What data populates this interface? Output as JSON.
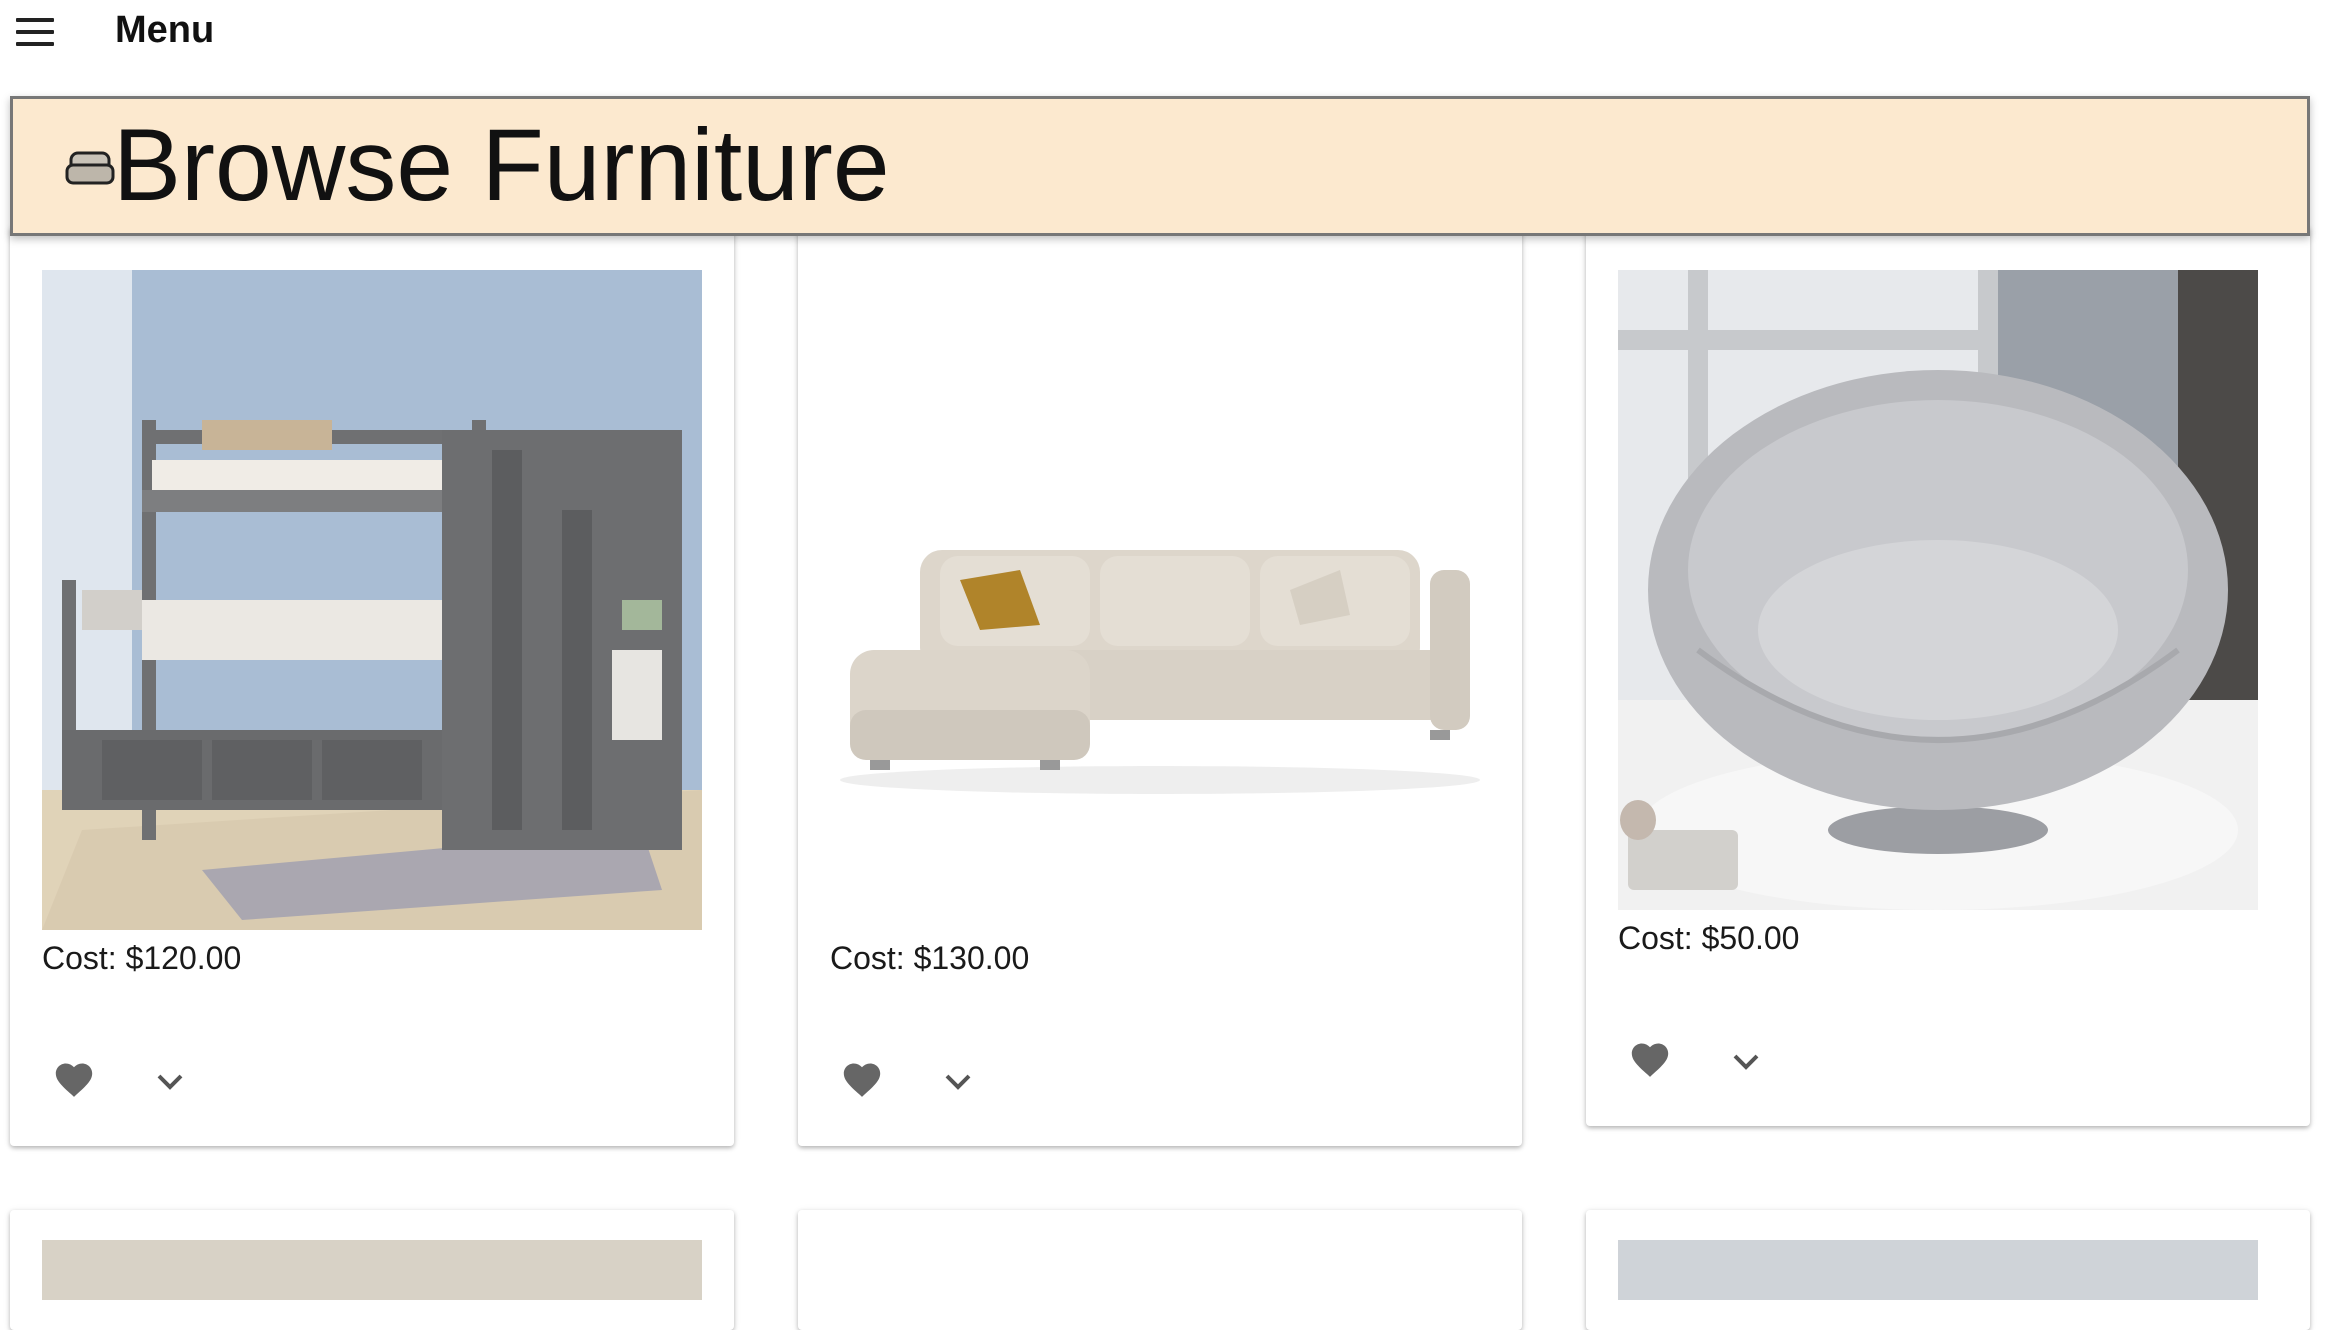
{
  "topbar": {
    "menu_label": "Menu",
    "menu_icon": "hamburger-icon"
  },
  "header": {
    "title": "Browse Furniture",
    "icon": "sofa-icon",
    "bg_color": "#fce9cf"
  },
  "products": [
    {
      "image": "bunk-bed",
      "cost": "Cost: $120.00"
    },
    {
      "image": "sectional-sofa",
      "cost": "Cost: $130.00"
    },
    {
      "image": "papasan-swivel-chair",
      "cost": "Cost: $50.00"
    }
  ],
  "colors": {
    "icon_gray": "#666666",
    "card_bg": "#ffffff"
  }
}
